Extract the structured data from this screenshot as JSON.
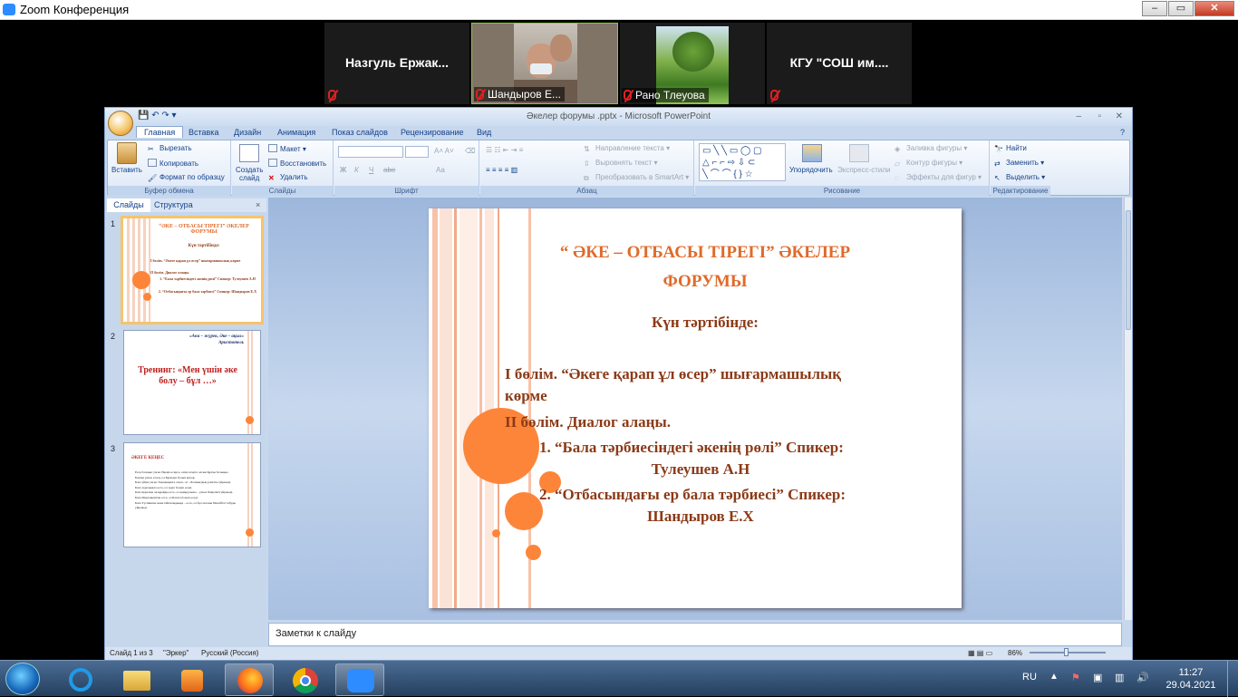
{
  "zoom": {
    "title": "Zoom Конференция",
    "participants": [
      {
        "name": "Назгуль  Ержак...",
        "video": false,
        "muted": true
      },
      {
        "name": "Шандыров Е...",
        "video": true,
        "muted": true
      },
      {
        "name": "Рано Тлеуова",
        "video": true,
        "muted": true
      },
      {
        "name": "КГУ  \"СОШ  им....",
        "video": false,
        "muted": true
      }
    ]
  },
  "ppt": {
    "title": "Әкелер форумы .pptx - Microsoft PowerPoint",
    "tabs": [
      "Главная",
      "Вставка",
      "Дизайн",
      "Анимация",
      "Показ слайдов",
      "Рецензирование",
      "Вид"
    ],
    "clipboard": {
      "paste": "Вставить",
      "cut": "Вырезать",
      "copy": "Копировать",
      "format_painter": "Формат по образцу",
      "label": "Буфер обмена"
    },
    "slides_group": {
      "new_slide_1": "Создать",
      "new_slide_2": "слайд",
      "layout": "Макет",
      "reset": "Восстановить",
      "delete": "Удалить",
      "label": "Слайды"
    },
    "font_group": {
      "label": "Шрифт",
      "b": "Ж",
      "i": "К",
      "u": "Ч",
      "s": "abe",
      "aa": "Aa"
    },
    "paragraph_group": {
      "text_direction": "Направление текста",
      "align_text": "Выровнять текст",
      "smartart": "Преобразовать в SmartArt",
      "label": "Абзац"
    },
    "drawing_group": {
      "arrange": "Упорядочить",
      "quick_styles": "Экспресс-стили",
      "fill": "Заливка фигуры",
      "outline": "Контур фигуры",
      "effects": "Эффекты для фигур",
      "label": "Рисование"
    },
    "editing_group": {
      "find": "Найти",
      "replace": "Заменить",
      "select": "Выделить",
      "label": "Редактирование"
    },
    "pane_tabs": {
      "slides": "Слайды",
      "outline": "Структура"
    },
    "thumbs": {
      "t1": {
        "num": "1",
        "title": "“ӘКЕ – ОТБАСЫ ТІРЕГІ” ӘКЕЛЕР ФОРУМЫ",
        "sub": "Күн тәртібінде:",
        "l1": "І бөлім. “Әкеге қарап ұл өсер” шығармашылық көрме",
        "l2": "ІІ бөлім. Диалог алаңы.",
        "l3": "1. “Бала тәрбиесіндегі әкенің рөлі” Спикер: Тулеушев А.Н",
        "l4": "2. “Отбасындағы ер бала тәрбиесі” Спикер: Шандыров Е.Х"
      },
      "t2": {
        "num": "2",
        "quote": "«Ана – жүрек, Әке – ақыл»",
        "author": "Аристотель",
        "title": "Тренинг: «Мен үшін әке болу – бұл …»"
      },
      "t3": {
        "num": "3",
        "title": "ӘКЕГЕ КЕҢЕС",
        "lines": [
          "Егер балаңыз уағыз Әкеңіз есирсе, өзіңі өзгерте алсын Құлзы болыңыз.",
          "Балаңа уағыз етсең, ол Бұлғына болып кетеді.",
          "Бала үйіне уағыз Тоқаныңызға сенсе, ол – Балаңыздың ұлағаты үйренеді.",
          "Бала Адалдықта өссе, ол Адал болып өседі.",
          "Бала Қорғаны алаңдайды өссе, ол қамқорлығы – уағыз Өмірлікті үйренеді.",
          "Бала Мақтаныштан өссе, ол Батаға болып өседі.",
          "Бала Түсінікпен және Ойлағандыққа – өссе, ол бұл пасаны Махаббат табуды үйренеді."
        ]
      }
    },
    "slide": {
      "title_line1": "“ ӘКЕ – ОТБАСЫ ТІРЕГІ” ӘКЕЛЕР",
      "title_line2": "ФОРУМЫ",
      "subtitle": "Күн тәртібінде:",
      "line1a": "І бөлім. “Әкеге қарап ұл өсер” шығармашылық",
      "line1b": "көрме",
      "line2": "ІІ бөлім. Диалог алаңы.",
      "item1a": "1. “Бала тәрбиесіндегі әкенің рөлі”  Спикер:",
      "item1b": "Тулеушев А.Н",
      "item2a": "2.  “Отбасындағы ер бала тәрбиесі” Спикер:",
      "item2b": "Шандыров Е.Х"
    },
    "notes_placeholder": "Заметки к слайду",
    "status": {
      "slide": "Слайд 1 из 3",
      "theme": "\"Эркер\"",
      "language": "Русский (Россия)",
      "zoom": "86%"
    }
  },
  "taskbar": {
    "lang": "RU",
    "time": "11:27",
    "date": "29.04.2021"
  },
  "colors": {
    "accent_orange": "#fd8539",
    "slide_text": "#8b3a17",
    "title_text": "#e06a2a"
  }
}
